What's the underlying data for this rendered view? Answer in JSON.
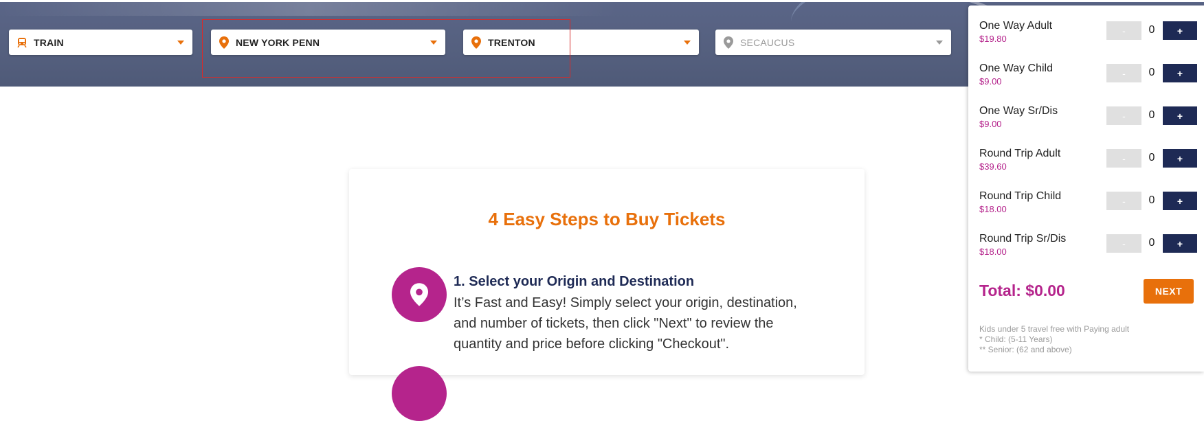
{
  "search": {
    "mode": {
      "label": "TRAIN",
      "icon": "train-icon"
    },
    "origin": {
      "label": "NEW YORK PENN",
      "icon": "location-pin-icon"
    },
    "destination": {
      "label": "TRENTON",
      "icon": "location-pin-icon"
    },
    "via": {
      "placeholder": "SECAUCUS",
      "icon": "location-pin-icon"
    }
  },
  "steps": {
    "title": "4 Easy Steps to Buy Tickets",
    "items": [
      {
        "title": "1. Select your Origin and Destination",
        "lines": [
          "It’s Fast and Easy! Simply select your origin, destination,",
          "and number of tickets, then click \"Next\" to review the",
          "quantity and price before clicking \"Checkout\"."
        ]
      }
    ]
  },
  "tickets": {
    "items": [
      {
        "name": "One Way Adult",
        "price": "$19.80",
        "qty": "0",
        "minus": "-",
        "plus": "+"
      },
      {
        "name": "One Way Child",
        "price": "$9.00",
        "qty": "0",
        "minus": "-",
        "plus": "+"
      },
      {
        "name": "One Way Sr/Dis",
        "price": "$9.00",
        "qty": "0",
        "minus": "-",
        "plus": "+"
      },
      {
        "name": "Round Trip Adult",
        "price": "$39.60",
        "qty": "0",
        "minus": "-",
        "plus": "+"
      },
      {
        "name": "Round Trip Child",
        "price": "$18.00",
        "qty": "0",
        "minus": "-",
        "plus": "+"
      },
      {
        "name": "Round Trip Sr/Dis",
        "price": "$18.00",
        "qty": "0",
        "minus": "-",
        "plus": "+"
      }
    ],
    "total": "Total: $0.00",
    "next_label": "NEXT",
    "notes": [
      "Kids under 5 travel free with Paying adult",
      "* Child: (5-11 Years)",
      "** Senior: (62 and above)"
    ]
  },
  "colors": {
    "accent_orange": "#e8700b",
    "accent_magenta": "#b5248c",
    "navy": "#1e2a55",
    "highlight_red": "#d62b2b"
  }
}
